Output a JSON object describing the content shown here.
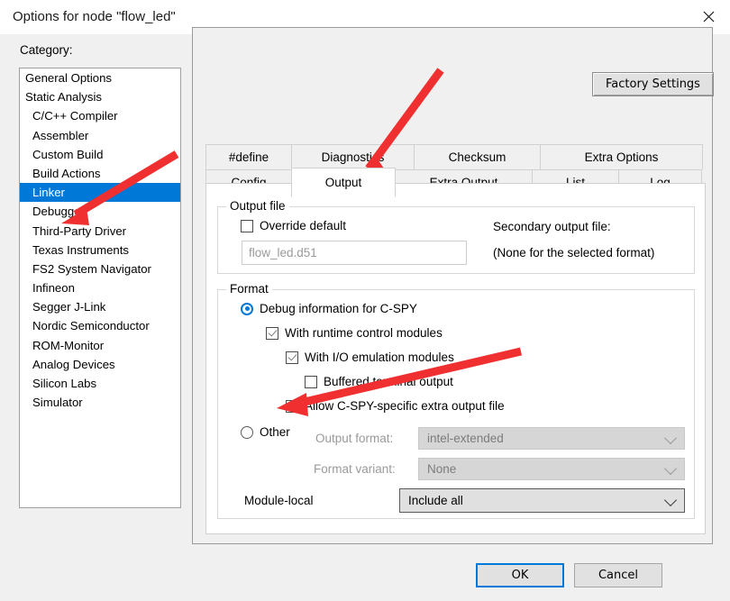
{
  "window": {
    "title": "Options for node \"flow_led\"",
    "close_icon": "close-icon"
  },
  "category": {
    "label": "Category:",
    "items": [
      {
        "label": "General Options",
        "indent": false,
        "selected": false
      },
      {
        "label": "Static Analysis",
        "indent": false,
        "selected": false
      },
      {
        "label": "C/C++ Compiler",
        "indent": true,
        "selected": false
      },
      {
        "label": "Assembler",
        "indent": true,
        "selected": false
      },
      {
        "label": "Custom Build",
        "indent": true,
        "selected": false
      },
      {
        "label": "Build Actions",
        "indent": true,
        "selected": false
      },
      {
        "label": "Linker",
        "indent": true,
        "selected": true
      },
      {
        "label": "Debugger",
        "indent": true,
        "selected": false
      },
      {
        "label": "Third-Party Driver",
        "indent": true,
        "selected": false
      },
      {
        "label": "Texas Instruments",
        "indent": true,
        "selected": false
      },
      {
        "label": "FS2 System Navigator",
        "indent": true,
        "selected": false
      },
      {
        "label": "Infineon",
        "indent": true,
        "selected": false
      },
      {
        "label": "Segger J-Link",
        "indent": true,
        "selected": false
      },
      {
        "label": "Nordic Semiconductor",
        "indent": true,
        "selected": false
      },
      {
        "label": "ROM-Monitor",
        "indent": true,
        "selected": false
      },
      {
        "label": "Analog Devices",
        "indent": true,
        "selected": false
      },
      {
        "label": "Silicon Labs",
        "indent": true,
        "selected": false
      },
      {
        "label": "Simulator",
        "indent": true,
        "selected": false
      }
    ]
  },
  "toolbar": {
    "factory_settings_label": "Factory Settings"
  },
  "tabs": {
    "row1": [
      {
        "label": "#define",
        "active": false,
        "width": 96
      },
      {
        "label": "Diagnostics",
        "active": false,
        "width": 137
      },
      {
        "label": "Checksum",
        "active": false,
        "width": 141
      },
      {
        "label": "Extra Options",
        "active": false,
        "width": 181
      }
    ],
    "row2": [
      {
        "label": "Config",
        "active": false,
        "width": 96
      },
      {
        "label": "Output",
        "active": true,
        "width": 116
      },
      {
        "label": "Extra Output",
        "active": false,
        "width": 153
      },
      {
        "label": "List",
        "active": false,
        "width": 97
      },
      {
        "label": "Log",
        "active": false,
        "width": 93
      }
    ]
  },
  "output_file": {
    "group_title": "Output file",
    "override_default": {
      "label": "Override default",
      "checked": false
    },
    "filename_value": "flow_led.d51",
    "secondary_label": "Secondary output file:",
    "secondary_value": "(None for the selected format)"
  },
  "format": {
    "group_title": "Format",
    "debug_radio": {
      "label": "Debug information for C-SPY",
      "selected": true
    },
    "with_runtime": {
      "label": "With runtime control modules",
      "checked": true
    },
    "with_io": {
      "label": "With I/O emulation modules",
      "checked": true
    },
    "buffered_terminal": {
      "label": "Buffered terminal output",
      "checked": false
    },
    "allow_cspy_extra": {
      "label": "Allow C-SPY-specific extra output file",
      "checked": true
    },
    "other_radio": {
      "label": "Other",
      "selected": false
    },
    "output_format": {
      "label": "Output format:",
      "value": "intel-extended",
      "disabled": true
    },
    "format_variant": {
      "label": "Format variant:",
      "value": "None",
      "disabled": true
    },
    "module_local": {
      "label": "Module-local",
      "value": "Include all",
      "disabled": false
    }
  },
  "footer": {
    "ok_label": "OK",
    "cancel_label": "Cancel"
  },
  "annotations": {
    "color": "#f03030",
    "arrows": [
      {
        "name": "arrow-to-linker",
        "target": "Linker"
      },
      {
        "name": "arrow-to-output-tab",
        "target": "Output"
      },
      {
        "name": "arrow-to-allow-cspy-checkbox",
        "target": "Allow C-SPY-specific extra output file"
      }
    ]
  }
}
